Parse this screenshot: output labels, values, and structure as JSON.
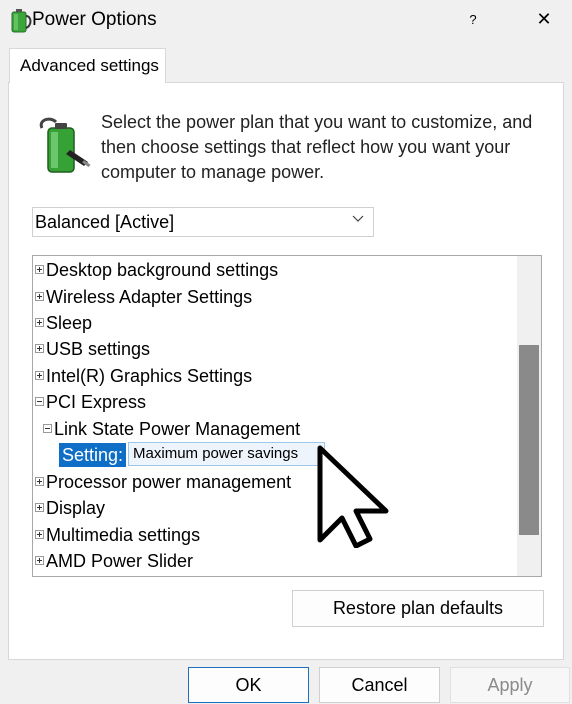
{
  "window": {
    "title": "Power Options",
    "help_label": "?",
    "close_label": "✕"
  },
  "tab": {
    "label": "Advanced settings"
  },
  "intro_text": "Select the power plan that you want to customize, and then choose settings that reflect how you want your computer to manage power.",
  "plan_select": {
    "value": "Balanced [Active]"
  },
  "tree": {
    "items": [
      {
        "label": "Desktop background settings",
        "expander": "plus"
      },
      {
        "label": "Wireless Adapter Settings",
        "expander": "plus"
      },
      {
        "label": "Sleep",
        "expander": "plus"
      },
      {
        "label": "USB settings",
        "expander": "plus"
      },
      {
        "label": "Intel(R) Graphics Settings",
        "expander": "plus"
      },
      {
        "label": "PCI Express",
        "expander": "minus"
      },
      {
        "label": "Link State Power Management",
        "expander": "minus"
      },
      {
        "setting_label": "Setting:",
        "setting_value": "Maximum power savings"
      },
      {
        "label": "Processor power management",
        "expander": "plus"
      },
      {
        "label": "Display",
        "expander": "plus"
      },
      {
        "label": "Multimedia settings",
        "expander": "plus"
      },
      {
        "label": "AMD Power Slider",
        "expander": "plus"
      }
    ]
  },
  "buttons": {
    "restore": "Restore plan defaults",
    "ok": "OK",
    "cancel": "Cancel",
    "apply": "Apply"
  },
  "colors": {
    "selection": "#0f6fc6",
    "scroll_thumb": "#8a8a8a",
    "battery_green": "#3aa63a"
  },
  "icons": [
    "power-options-icon",
    "battery-plug-icon",
    "chevron-down-icon",
    "mouse-pointer-icon"
  ]
}
